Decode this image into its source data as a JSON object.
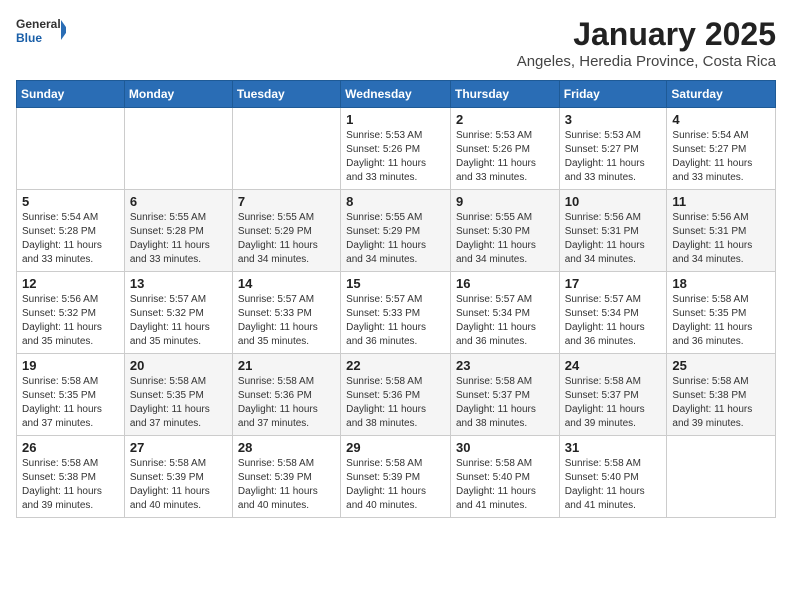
{
  "header": {
    "logo_general": "General",
    "logo_blue": "Blue",
    "title": "January 2025",
    "subtitle": "Angeles, Heredia Province, Costa Rica"
  },
  "weekdays": [
    "Sunday",
    "Monday",
    "Tuesday",
    "Wednesday",
    "Thursday",
    "Friday",
    "Saturday"
  ],
  "weeks": [
    {
      "days": [
        {
          "number": "",
          "info": ""
        },
        {
          "number": "",
          "info": ""
        },
        {
          "number": "",
          "info": ""
        },
        {
          "number": "1",
          "info": "Sunrise: 5:53 AM\nSunset: 5:26 PM\nDaylight: 11 hours\nand 33 minutes."
        },
        {
          "number": "2",
          "info": "Sunrise: 5:53 AM\nSunset: 5:26 PM\nDaylight: 11 hours\nand 33 minutes."
        },
        {
          "number": "3",
          "info": "Sunrise: 5:53 AM\nSunset: 5:27 PM\nDaylight: 11 hours\nand 33 minutes."
        },
        {
          "number": "4",
          "info": "Sunrise: 5:54 AM\nSunset: 5:27 PM\nDaylight: 11 hours\nand 33 minutes."
        }
      ]
    },
    {
      "days": [
        {
          "number": "5",
          "info": "Sunrise: 5:54 AM\nSunset: 5:28 PM\nDaylight: 11 hours\nand 33 minutes."
        },
        {
          "number": "6",
          "info": "Sunrise: 5:55 AM\nSunset: 5:28 PM\nDaylight: 11 hours\nand 33 minutes."
        },
        {
          "number": "7",
          "info": "Sunrise: 5:55 AM\nSunset: 5:29 PM\nDaylight: 11 hours\nand 34 minutes."
        },
        {
          "number": "8",
          "info": "Sunrise: 5:55 AM\nSunset: 5:29 PM\nDaylight: 11 hours\nand 34 minutes."
        },
        {
          "number": "9",
          "info": "Sunrise: 5:55 AM\nSunset: 5:30 PM\nDaylight: 11 hours\nand 34 minutes."
        },
        {
          "number": "10",
          "info": "Sunrise: 5:56 AM\nSunset: 5:31 PM\nDaylight: 11 hours\nand 34 minutes."
        },
        {
          "number": "11",
          "info": "Sunrise: 5:56 AM\nSunset: 5:31 PM\nDaylight: 11 hours\nand 34 minutes."
        }
      ]
    },
    {
      "days": [
        {
          "number": "12",
          "info": "Sunrise: 5:56 AM\nSunset: 5:32 PM\nDaylight: 11 hours\nand 35 minutes."
        },
        {
          "number": "13",
          "info": "Sunrise: 5:57 AM\nSunset: 5:32 PM\nDaylight: 11 hours\nand 35 minutes."
        },
        {
          "number": "14",
          "info": "Sunrise: 5:57 AM\nSunset: 5:33 PM\nDaylight: 11 hours\nand 35 minutes."
        },
        {
          "number": "15",
          "info": "Sunrise: 5:57 AM\nSunset: 5:33 PM\nDaylight: 11 hours\nand 36 minutes."
        },
        {
          "number": "16",
          "info": "Sunrise: 5:57 AM\nSunset: 5:34 PM\nDaylight: 11 hours\nand 36 minutes."
        },
        {
          "number": "17",
          "info": "Sunrise: 5:57 AM\nSunset: 5:34 PM\nDaylight: 11 hours\nand 36 minutes."
        },
        {
          "number": "18",
          "info": "Sunrise: 5:58 AM\nSunset: 5:35 PM\nDaylight: 11 hours\nand 36 minutes."
        }
      ]
    },
    {
      "days": [
        {
          "number": "19",
          "info": "Sunrise: 5:58 AM\nSunset: 5:35 PM\nDaylight: 11 hours\nand 37 minutes."
        },
        {
          "number": "20",
          "info": "Sunrise: 5:58 AM\nSunset: 5:35 PM\nDaylight: 11 hours\nand 37 minutes."
        },
        {
          "number": "21",
          "info": "Sunrise: 5:58 AM\nSunset: 5:36 PM\nDaylight: 11 hours\nand 37 minutes."
        },
        {
          "number": "22",
          "info": "Sunrise: 5:58 AM\nSunset: 5:36 PM\nDaylight: 11 hours\nand 38 minutes."
        },
        {
          "number": "23",
          "info": "Sunrise: 5:58 AM\nSunset: 5:37 PM\nDaylight: 11 hours\nand 38 minutes."
        },
        {
          "number": "24",
          "info": "Sunrise: 5:58 AM\nSunset: 5:37 PM\nDaylight: 11 hours\nand 39 minutes."
        },
        {
          "number": "25",
          "info": "Sunrise: 5:58 AM\nSunset: 5:38 PM\nDaylight: 11 hours\nand 39 minutes."
        }
      ]
    },
    {
      "days": [
        {
          "number": "26",
          "info": "Sunrise: 5:58 AM\nSunset: 5:38 PM\nDaylight: 11 hours\nand 39 minutes."
        },
        {
          "number": "27",
          "info": "Sunrise: 5:58 AM\nSunset: 5:39 PM\nDaylight: 11 hours\nand 40 minutes."
        },
        {
          "number": "28",
          "info": "Sunrise: 5:58 AM\nSunset: 5:39 PM\nDaylight: 11 hours\nand 40 minutes."
        },
        {
          "number": "29",
          "info": "Sunrise: 5:58 AM\nSunset: 5:39 PM\nDaylight: 11 hours\nand 40 minutes."
        },
        {
          "number": "30",
          "info": "Sunrise: 5:58 AM\nSunset: 5:40 PM\nDaylight: 11 hours\nand 41 minutes."
        },
        {
          "number": "31",
          "info": "Sunrise: 5:58 AM\nSunset: 5:40 PM\nDaylight: 11 hours\nand 41 minutes."
        },
        {
          "number": "",
          "info": ""
        }
      ]
    }
  ]
}
